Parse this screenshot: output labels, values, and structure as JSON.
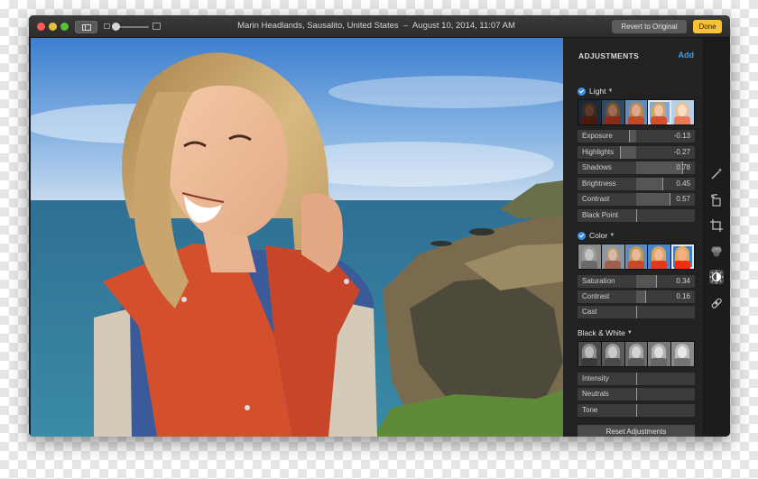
{
  "window": {
    "title": "Marin Headlands, Sausalito, United States",
    "date": "August 10, 2014, 11:07 AM",
    "revert_label": "Revert to Original",
    "done_label": "Done"
  },
  "panel": {
    "header": "ADJUSTMENTS",
    "add_label": "Add",
    "sections": {
      "light": {
        "label": "Light",
        "sliders": [
          {
            "label": "Exposure",
            "value": "-0.13",
            "fraction": -0.13
          },
          {
            "label": "Highlights",
            "value": "-0.27",
            "fraction": -0.27
          },
          {
            "label": "Shadows",
            "value": "0.78",
            "fraction": 0.78
          },
          {
            "label": "Brightness",
            "value": "0.45",
            "fraction": 0.45
          },
          {
            "label": "Contrast",
            "value": "0.57",
            "fraction": 0.57
          },
          {
            "label": "Black Point",
            "value": "",
            "fraction": 0
          }
        ]
      },
      "color": {
        "label": "Color",
        "sliders": [
          {
            "label": "Saturation",
            "value": "0.34",
            "fraction": 0.34
          },
          {
            "label": "Contrast",
            "value": "0.16",
            "fraction": 0.16
          },
          {
            "label": "Cast",
            "value": "",
            "fraction": 0
          }
        ]
      },
      "bw": {
        "label": "Black & White",
        "sliders": [
          {
            "label": "Intensity",
            "value": "",
            "fraction": 0
          },
          {
            "label": "Neutrals",
            "value": "",
            "fraction": 0
          },
          {
            "label": "Tone",
            "value": "",
            "fraction": 0
          }
        ]
      }
    },
    "reset_label": "Reset Adjustments"
  },
  "toolstrip": [
    "magic-wand-icon",
    "rotate-icon",
    "crop-icon",
    "filters-icon",
    "adjust-icon",
    "retouch-icon"
  ],
  "colors": {
    "accent": "#3b8eea",
    "done": "#f7c234",
    "vest": "#d4502c"
  }
}
